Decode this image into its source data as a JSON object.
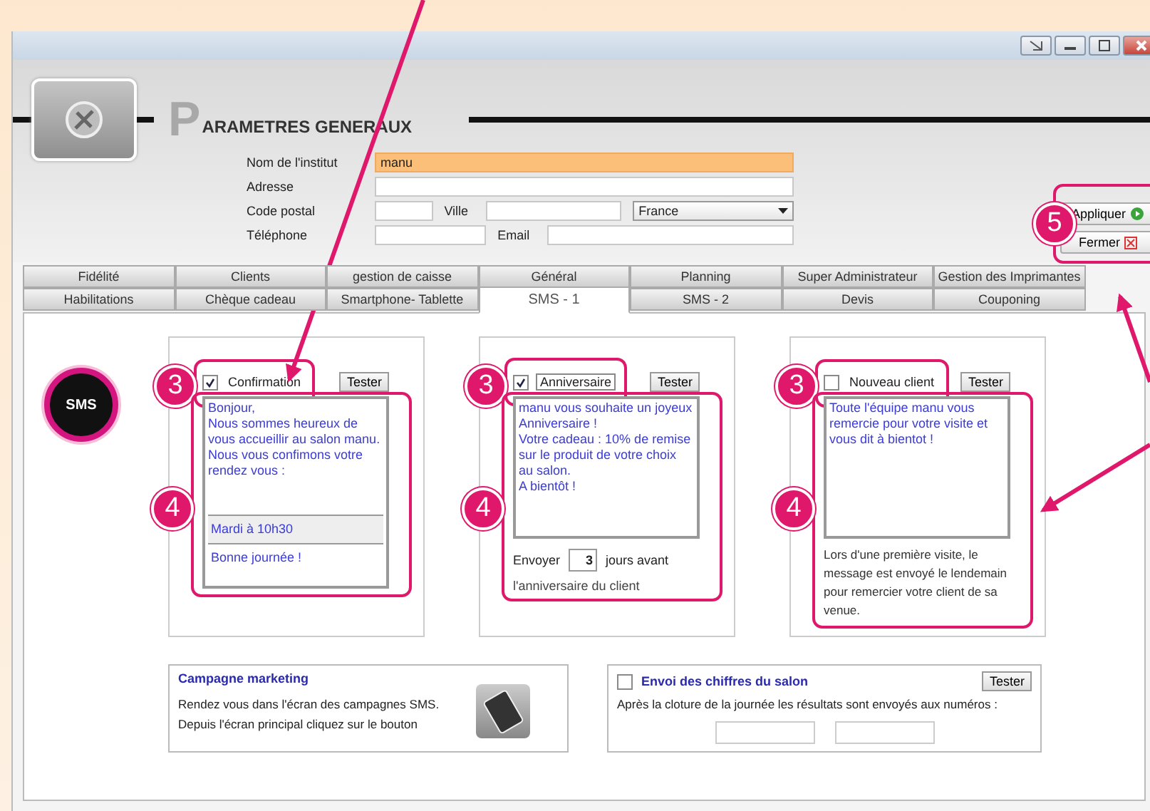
{
  "header": {
    "title_initial": "P",
    "title_rest": "ARAMETRES GENERAUX"
  },
  "form": {
    "name_label": "Nom de l'institut",
    "name_value": "manu",
    "address_label": "Adresse",
    "postal_label": "Code postal",
    "city_label": "Ville",
    "country_value": "France",
    "phone_label": "Téléphone",
    "email_label": "Email"
  },
  "actions": {
    "callout": "5",
    "buttons": [
      {
        "label": "Appliquer",
        "kind": "apply"
      },
      {
        "label": "Fermer",
        "kind": "close"
      }
    ]
  },
  "tabs": [
    {
      "label": "Fidélité",
      "selected": false
    },
    {
      "label": "Clients",
      "selected": false
    },
    {
      "label": "gestion de caisse",
      "selected": false
    },
    {
      "label": "Général",
      "selected": false
    },
    {
      "label": "Planning",
      "selected": false
    },
    {
      "label": "Super Administrateur",
      "selected": false
    },
    {
      "label": "Gestion des Imprimantes",
      "selected": false
    },
    {
      "label": "Habilitations",
      "selected": false
    },
    {
      "label": "Chèque cadeau",
      "selected": false
    },
    {
      "label": "Smartphone- Tablette",
      "selected": false
    },
    {
      "label": "SMS - 1",
      "selected": true
    },
    {
      "label": "SMS - 2",
      "selected": false
    },
    {
      "label": "Devis",
      "selected": false
    },
    {
      "label": "Couponing",
      "selected": false
    }
  ],
  "sms_badge": "SMS",
  "cards": [
    {
      "kind": "split",
      "label": "Confirmation",
      "checked": true,
      "focused": false,
      "test_button": "Tester",
      "check_callout": "3",
      "message_callout": "4",
      "message": "Bonjour,\nNous sommes heureux de vous accueillir au salon manu.\nNous vous confimons votre rendez vous :",
      "highlight": "Mardi à 10h30",
      "closing": "Bonne journée !"
    },
    {
      "kind": "send_days",
      "label": "Anniversaire",
      "checked": true,
      "focused": true,
      "test_button": "Tester",
      "check_callout": "3",
      "message_callout": "4",
      "message": "manu vous souhaite un joyeux\nAnniversaire !\nVotre cadeau : 10% de remise sur le produit de votre choix au salon.\nA bientôt !",
      "send_prefix": "Envoyer",
      "send_value": "3",
      "send_suffix": "jours avant",
      "footnote": "l'anniversaire du client"
    },
    {
      "kind": "note",
      "label": "Nouveau client",
      "checked": false,
      "focused": false,
      "test_button": "Tester",
      "check_callout": "3",
      "message_callout": "4",
      "message": "Toute l'équipe manu vous remercie pour votre visite et vous dit à bientot !",
      "note": "Lors d'une première visite, le message est envoyé le lendemain pour remercier votre client de sa venue."
    }
  ],
  "marketing": {
    "title": "Campagne marketing",
    "lines": [
      "Rendez vous dans l'écran des campagnes SMS.",
      "Depuis l'écran principal cliquez sur le bouton"
    ]
  },
  "figures": {
    "label": "Envoi des chiffres du salon",
    "checked": false,
    "test_button": "Tester",
    "text": "Après la cloture de la journée les résultats sont envoyés aux numéros :"
  }
}
